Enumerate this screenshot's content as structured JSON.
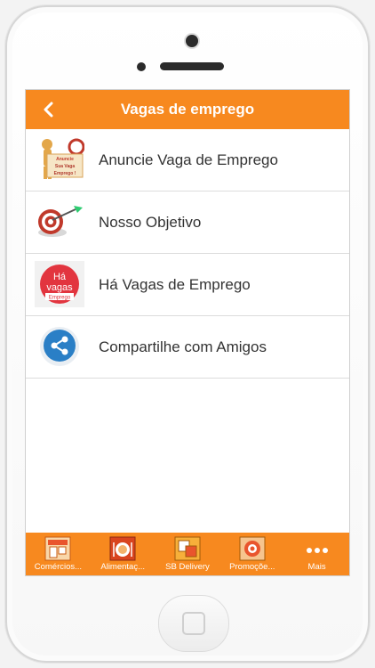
{
  "header": {
    "title": "Vagas de emprego",
    "back_icon": "chevron-left-icon"
  },
  "menu": [
    {
      "label": "Anuncie Vaga de Emprego",
      "icon": "megaphone-person-icon",
      "icon_text": [
        "Anuncie",
        "Sua Vaga",
        "Emprego !"
      ]
    },
    {
      "label": "Nosso Objetivo",
      "icon": "target-dart-icon"
    },
    {
      "label": "Há Vagas de Emprego",
      "icon": "ha-vagas-badge-icon",
      "icon_text": [
        "Há",
        "vagas",
        "Emprego"
      ]
    },
    {
      "label": "Compartilhe com Amigos",
      "icon": "share-icon"
    }
  ],
  "tabs": [
    {
      "label": "Comércios...",
      "icon": "store-icon"
    },
    {
      "label": "Alimentaç...",
      "icon": "food-icon"
    },
    {
      "label": "SB Delivery",
      "icon": "delivery-icon"
    },
    {
      "label": "Promoçõe...",
      "icon": "promo-icon"
    },
    {
      "label": "Mais",
      "icon": "more-dots-icon"
    }
  ],
  "colors": {
    "accent": "#f7891f",
    "text": "#333333",
    "divider": "#dcdcdc"
  }
}
